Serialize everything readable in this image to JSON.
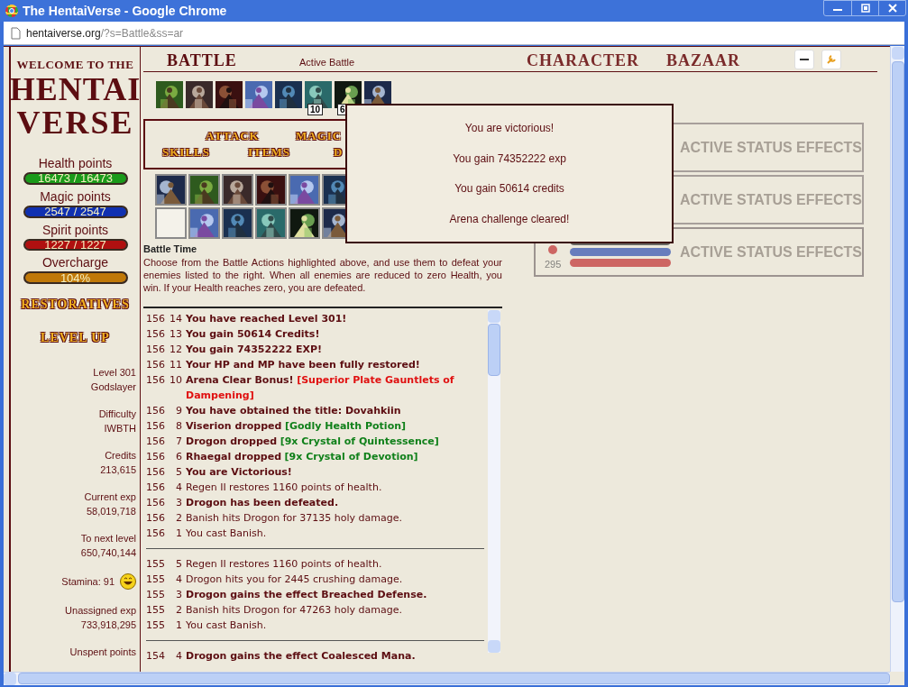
{
  "window": {
    "title": "The HentaiVerse - Google Chrome"
  },
  "address_bar": {
    "host": "hentaiverse.org",
    "path": "/?s=Battle&ss=ar"
  },
  "sidebar": {
    "logo": [
      "WELCOME TO THE",
      "HENTAI",
      "VERSE"
    ],
    "bars": [
      {
        "label": "Health points",
        "reading": "16473 / 16473",
        "level": 1,
        "color": "#1a9a1a"
      },
      {
        "label": "Magic points",
        "reading": "2547 / 2547",
        "level": 1,
        "color": "#1030b0"
      },
      {
        "label": "Spirit points",
        "reading": "1227 / 1227",
        "level": 1,
        "color": "#b01010"
      },
      {
        "label": "Overcharge",
        "reading": "104%",
        "level": 1,
        "color": "#c07808"
      }
    ],
    "links": [
      "RESTORATIVES",
      "LEVEL UP"
    ],
    "stats": [
      {
        "label": "Level 301",
        "value": "Godslayer"
      },
      {
        "label": "Difficulty",
        "value": "IWBTH"
      },
      {
        "label": "Credits",
        "value": "213,615"
      },
      {
        "label": "Current exp",
        "value": "58,019,718"
      },
      {
        "label": "To next level",
        "value": "650,740,144"
      },
      {
        "label": "Stamina: 91",
        "kind": "stamina"
      },
      {
        "label": "Unassigned exp",
        "value": "733,918,295"
      },
      {
        "label": "Unspent points"
      }
    ]
  },
  "nav": {
    "items": [
      {
        "label": "BATTLE",
        "selected": true
      },
      {
        "label": "CHARACTER",
        "selected": false
      },
      {
        "label": "BAZAAR",
        "selected": false
      }
    ],
    "subtitle": "Active Battle"
  },
  "effects": [
    {
      "kind": "effect"
    },
    {
      "kind": "effect"
    },
    {
      "kind": "effect"
    },
    {
      "kind": "effect"
    },
    {
      "kind": "effect"
    },
    {
      "kind": "effect",
      "count": "10"
    },
    {
      "kind": "effect",
      "count": "6"
    },
    {
      "kind": "effect"
    }
  ],
  "action_menu": [
    [
      "ATTACK",
      "MAGIC"
    ],
    [
      "SKILLS",
      "ITEMS",
      "D"
    ]
  ],
  "skills": [
    [
      {
        "kind": "skill"
      },
      {
        "kind": "skill"
      },
      {
        "kind": "skill"
      },
      {
        "kind": "skill"
      },
      {
        "kind": "skill"
      },
      {
        "kind": "skill"
      }
    ],
    [
      {
        "kind": "empty"
      },
      {
        "kind": "skill"
      },
      {
        "kind": "skill"
      },
      {
        "kind": "skill"
      },
      {
        "kind": "skill"
      },
      {
        "kind": "skill"
      }
    ]
  ],
  "battle_time": {
    "title": "Battle Time",
    "text": "Choose from the Battle Actions highlighted above, and use them to defeat your enemies listed to the right. When all enemies are reduced to zero Health, you win. If your Health reaches zero, you are defeated."
  },
  "log": [
    [
      {
        "round": "156",
        "num": "14",
        "parts": [
          {
            "kind": "event",
            "text": "You have reached Level 301!"
          }
        ]
      },
      {
        "round": "156",
        "num": "13",
        "parts": [
          {
            "kind": "event",
            "text": "You gain 50614 Credits!"
          }
        ]
      },
      {
        "round": "156",
        "num": "12",
        "parts": [
          {
            "kind": "event",
            "text": "You gain 74352222 EXP!"
          }
        ]
      },
      {
        "round": "156",
        "num": "11",
        "parts": [
          {
            "kind": "event",
            "text": "Your HP and MP have been fully restored!"
          }
        ]
      },
      {
        "round": "156",
        "num": "10",
        "parts": [
          {
            "kind": "event",
            "text": "Arena Clear Bonus!"
          },
          {
            "kind": "rare",
            "text": "[Superior Plate Gauntlets of Dampening]"
          }
        ]
      },
      {
        "round": "156",
        "num": "9",
        "parts": [
          {
            "kind": "event",
            "text": "You have obtained the title: Dovahkiin"
          }
        ]
      },
      {
        "round": "156",
        "num": "8",
        "parts": [
          {
            "kind": "event",
            "text": "Viserion dropped"
          },
          {
            "kind": "item",
            "text": "[Godly Health Potion]"
          }
        ]
      },
      {
        "round": "156",
        "num": "7",
        "parts": [
          {
            "kind": "event",
            "text": "Drogon dropped"
          },
          {
            "kind": "item",
            "text": "[9x Crystal of Quintessence]"
          }
        ]
      },
      {
        "round": "156",
        "num": "6",
        "parts": [
          {
            "kind": "event",
            "text": "Rhaegal dropped"
          },
          {
            "kind": "item",
            "text": "[9x Crystal of Devotion]"
          }
        ]
      },
      {
        "round": "156",
        "num": "5",
        "parts": [
          {
            "kind": "event",
            "text": "You are Victorious!"
          }
        ]
      },
      {
        "round": "156",
        "num": "4",
        "parts": [
          {
            "kind": "plain",
            "text": "Regen II restores 1160 points of health."
          }
        ]
      },
      {
        "round": "156",
        "num": "3",
        "parts": [
          {
            "kind": "event",
            "text": "Drogon has been defeated."
          }
        ]
      },
      {
        "round": "156",
        "num": "2",
        "parts": [
          {
            "kind": "plain",
            "text": "Banish hits Drogon for 37135 holy damage."
          }
        ]
      },
      {
        "round": "156",
        "num": "1",
        "parts": [
          {
            "kind": "plain",
            "text": "You cast Banish."
          }
        ]
      }
    ],
    [
      {
        "round": "155",
        "num": "5",
        "parts": [
          {
            "kind": "plain",
            "text": "Regen II restores 1160 points of health."
          }
        ]
      },
      {
        "round": "155",
        "num": "4",
        "parts": [
          {
            "kind": "plain",
            "text": "Drogon hits you for 2445 crushing damage."
          }
        ]
      },
      {
        "round": "155",
        "num": "3",
        "parts": [
          {
            "kind": "event",
            "text": "Drogon gains the effect Breached Defense."
          }
        ]
      },
      {
        "round": "155",
        "num": "2",
        "parts": [
          {
            "kind": "plain",
            "text": "Banish hits Drogon for 47263 holy damage."
          }
        ]
      },
      {
        "round": "155",
        "num": "1",
        "parts": [
          {
            "kind": "plain",
            "text": "You cast Banish."
          }
        ]
      }
    ],
    [
      {
        "round": "154",
        "num": "4",
        "parts": [
          {
            "kind": "event",
            "text": "Drogon gains the effect Coalesced Mana."
          }
        ]
      }
    ]
  ],
  "monsters": [
    {
      "status": "ACTIVE STATUS EFFECTS",
      "dead": false
    },
    {
      "status": "ACTIVE STATUS EFFECTS",
      "dead": false
    },
    {
      "status": "ACTIVE STATUS EFFECTS",
      "dead": true,
      "number": "295",
      "bars_shown": true
    }
  ],
  "popup": {
    "lines": [
      "You are victorious!",
      "You gain 74352222 exp",
      "You gain 50614 credits",
      "Arena challenge cleared!"
    ]
  }
}
